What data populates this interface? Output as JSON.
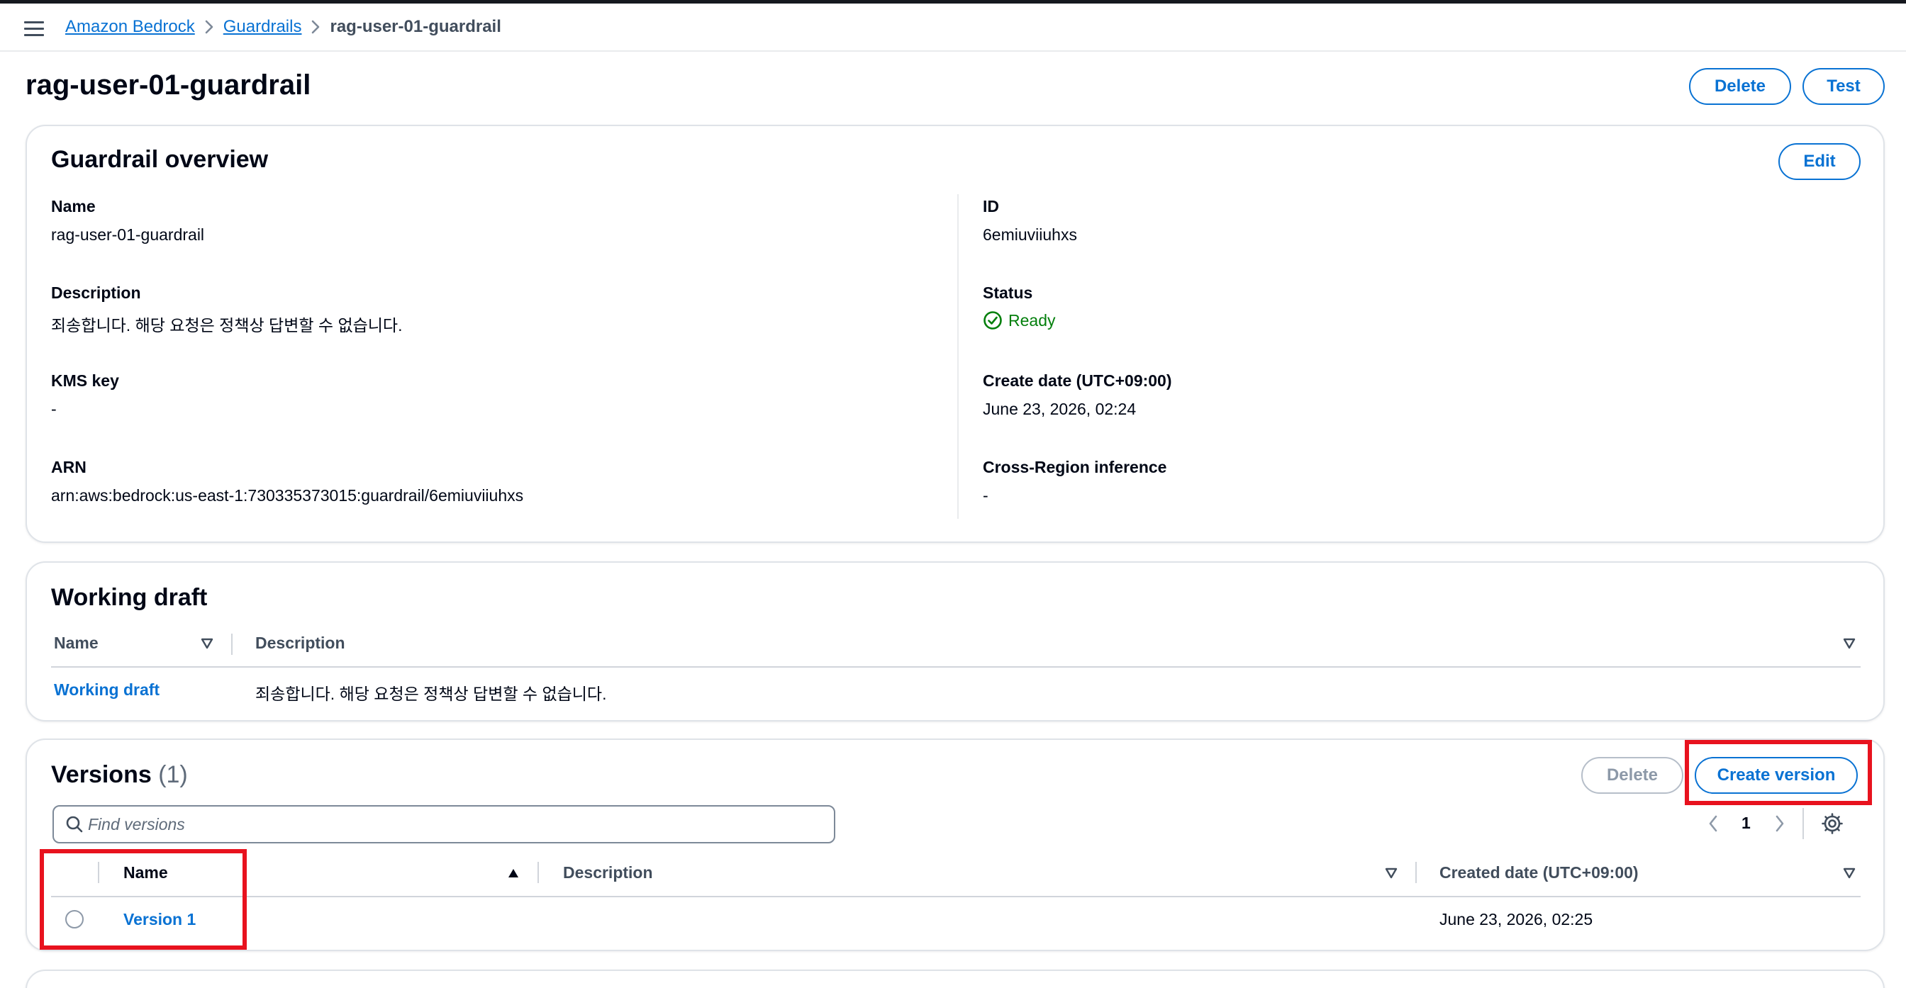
{
  "breadcrumbs": {
    "items": [
      "Amazon Bedrock",
      "Guardrails"
    ],
    "current": "rag-user-01-guardrail"
  },
  "header": {
    "title": "rag-user-01-guardrail",
    "delete_label": "Delete",
    "test_label": "Test"
  },
  "overview": {
    "title": "Guardrail overview",
    "edit_label": "Edit",
    "name_label": "Name",
    "name_value": "rag-user-01-guardrail",
    "description_label": "Description",
    "description_value": "죄송합니다. 해당 요청은 정책상 답변할 수 없습니다.",
    "kms_label": "KMS key",
    "kms_value": "-",
    "arn_label": "ARN",
    "arn_value": "arn:aws:bedrock:us-east-1:730335373015:guardrail/6emiuviiuhxs",
    "id_label": "ID",
    "id_value": "6emiuviiuhxs",
    "status_label": "Status",
    "status_value": "Ready",
    "create_date_label": "Create date (UTC+09:00)",
    "create_date_value": "June 23, 2026, 02:24",
    "cross_region_label": "Cross-Region inference",
    "cross_region_value": "-"
  },
  "working_draft": {
    "title": "Working draft",
    "col_name": "Name",
    "col_description": "Description",
    "row_name": "Working draft",
    "row_description": "죄송합니다. 해당 요청은 정책상 답변할 수 없습니다."
  },
  "versions": {
    "title": "Versions",
    "count": "(1)",
    "delete_label": "Delete",
    "create_label": "Create version",
    "search_placeholder": "Find versions",
    "page_number": "1",
    "col_name": "Name",
    "col_description": "Description",
    "col_created": "Created date (UTC+09:00)",
    "rows": [
      {
        "name": "Version 1",
        "description": "",
        "created": "June 23, 2026, 02:25"
      }
    ]
  },
  "colors": {
    "link": "#0972d3",
    "ready": "#037f0c",
    "highlight": "#e8121e"
  }
}
